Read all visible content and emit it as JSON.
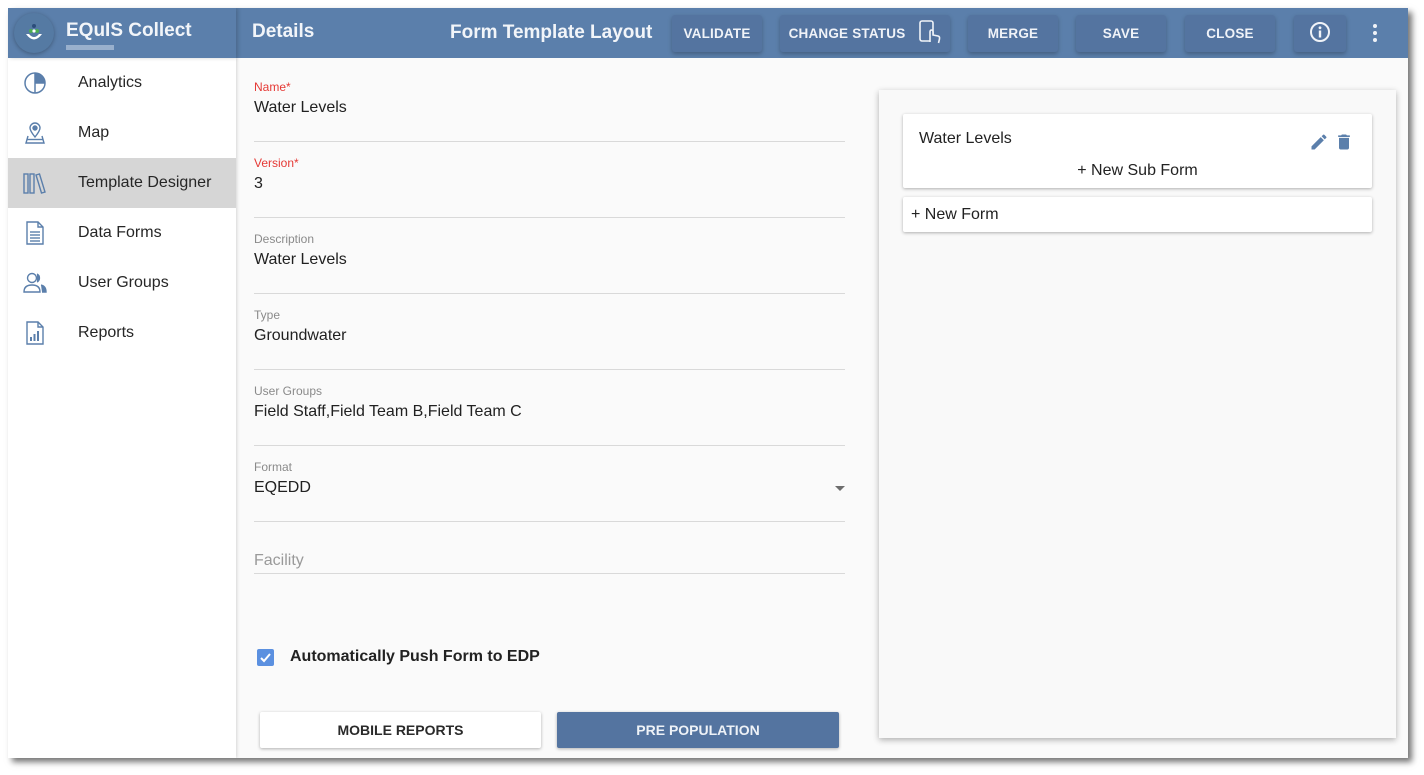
{
  "app": {
    "title": "EQuIS Collect",
    "section_title": "Details",
    "layout_title": "Form Template Layout",
    "colors": {
      "header": "#5b7fab",
      "button": "#5474a0",
      "required_label": "#e53935",
      "checkbox": "#5b90e0",
      "icon": "#5b7fab"
    }
  },
  "toolbar": {
    "validate_label": "VALIDATE",
    "change_status_label": "CHANGE STATUS",
    "change_status_icon": "tablet-touch-icon",
    "merge_label": "MERGE",
    "save_label": "SAVE",
    "close_label": "CLOSE",
    "info_icon": "info-icon",
    "more_icon": "more-vertical-icon"
  },
  "sidebar": {
    "items": [
      {
        "label": "Analytics",
        "icon": "pie-chart-icon",
        "active": false
      },
      {
        "label": "Map",
        "icon": "map-pin-icon",
        "active": false
      },
      {
        "label": "Template Designer",
        "icon": "library-icon",
        "active": true
      },
      {
        "label": "Data Forms",
        "icon": "document-icon",
        "active": false
      },
      {
        "label": "User Groups",
        "icon": "users-icon",
        "active": false
      },
      {
        "label": "Reports",
        "icon": "report-icon",
        "active": false
      }
    ]
  },
  "form": {
    "name": {
      "label": "Name",
      "required_mark": "*",
      "value": "Water Levels"
    },
    "version": {
      "label": "Version",
      "required_mark": "*",
      "value": "3"
    },
    "description": {
      "label": "Description",
      "value": "Water Levels"
    },
    "type": {
      "label": "Type",
      "value": "Groundwater"
    },
    "user_groups": {
      "label": "User Groups",
      "value": "Field Staff,Field Team B,Field Team C"
    },
    "format": {
      "label": "Format",
      "value": "EQEDD"
    },
    "facility": {
      "placeholder": "Facility",
      "value": ""
    },
    "auto_push": {
      "label": "Automatically Push Form to EDP",
      "checked": true
    },
    "mobile_reports_label": "MOBILE REPORTS",
    "pre_population_label": "PRE POPULATION"
  },
  "layout": {
    "forms": [
      {
        "title": "Water Levels",
        "new_sub_form_label": "+ New Sub Form"
      }
    ],
    "new_form_label": "+ New Form"
  }
}
